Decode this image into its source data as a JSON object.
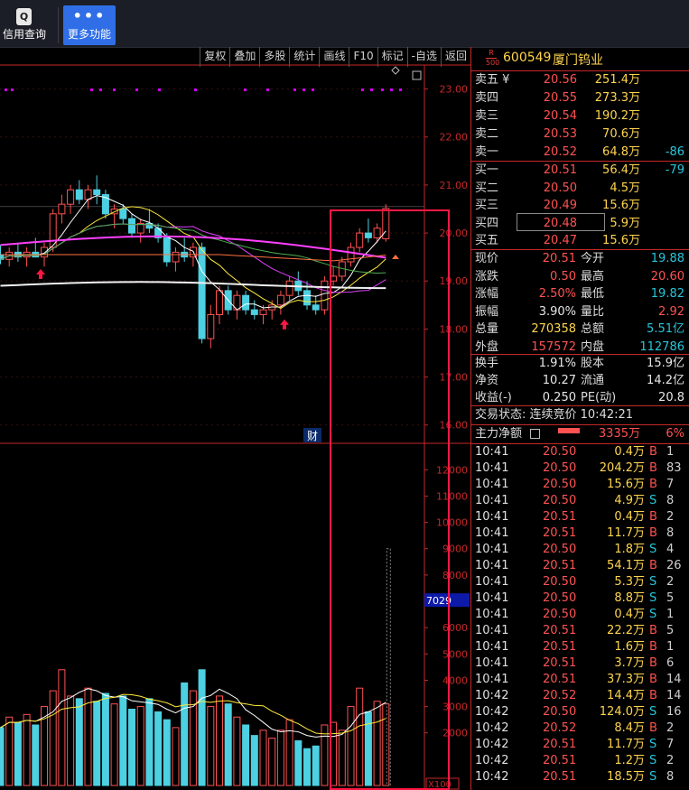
{
  "toolbar": {
    "credit_label": "信用查询",
    "credit_icon": "Q",
    "more_label": "更多功能",
    "more_icon": "•••"
  },
  "chart_toolbar": [
    "复权",
    "叠加",
    "多股",
    "统计",
    "画线",
    "F10",
    "标记",
    "-自选",
    "返回"
  ],
  "price_axis": [
    "23.00",
    "22.00",
    "21.00",
    "20.00",
    "19.00",
    "18.00",
    "17.00",
    "16.00"
  ],
  "volume_axis": [
    "12000",
    "11000",
    "10000",
    "9000",
    "8000",
    "7000",
    "6000",
    "5000",
    "4000",
    "3000",
    "2000"
  ],
  "volume_unit": "X100",
  "volume_marker": "7029",
  "chart_marker": "财",
  "stock": {
    "badge_r": "R",
    "badge_500": "500",
    "code": "600549",
    "name": "厦门钨业"
  },
  "asks": [
    {
      "label": "卖五 ¥",
      "price": "20.56",
      "vol": "251.4万",
      "diff": ""
    },
    {
      "label": "卖四",
      "price": "20.55",
      "vol": "273.3万",
      "diff": ""
    },
    {
      "label": "卖三",
      "price": "20.54",
      "vol": "190.2万",
      "diff": ""
    },
    {
      "label": "卖二",
      "price": "20.53",
      "vol": "70.6万",
      "diff": ""
    },
    {
      "label": "卖一",
      "price": "20.52",
      "vol": "64.8万",
      "diff": "-86"
    }
  ],
  "bids": [
    {
      "label": "买一",
      "price": "20.51",
      "vol": "56.4万",
      "diff": "-79"
    },
    {
      "label": "买二",
      "price": "20.50",
      "vol": "4.5万",
      "diff": ""
    },
    {
      "label": "买三",
      "price": "20.49",
      "vol": "15.6万",
      "diff": ""
    },
    {
      "label": "买四",
      "price": "20.48",
      "vol": "5.9万",
      "diff": ""
    },
    {
      "label": "买五",
      "price": "20.47",
      "vol": "15.6万",
      "diff": ""
    }
  ],
  "quote": [
    {
      "l1": "现价",
      "v1": "20.51",
      "c1": "red",
      "l2": "今开",
      "v2": "19.88",
      "c2": "cyan"
    },
    {
      "l1": "涨跌",
      "v1": "0.50",
      "c1": "red",
      "l2": "最高",
      "v2": "20.60",
      "c2": "red"
    },
    {
      "l1": "涨幅",
      "v1": "2.50%",
      "c1": "red",
      "l2": "最低",
      "v2": "19.82",
      "c2": "cyan"
    },
    {
      "l1": "振幅",
      "v1": "3.90%",
      "c1": "white",
      "l2": "量比",
      "v2": "2.92",
      "c2": "red"
    },
    {
      "l1": "总量",
      "v1": "270358",
      "c1": "yellow",
      "l2": "总额",
      "v2": "5.51亿",
      "c2": "cyan"
    },
    {
      "l1": "外盘",
      "v1": "157572",
      "c1": "red",
      "l2": "内盘",
      "v2": "112786",
      "c2": "cyan"
    }
  ],
  "fundamentals": [
    {
      "l1": "换手",
      "v1": "1.91%",
      "l2": "股本",
      "v2": "15.9亿"
    },
    {
      "l1": "净资",
      "v1": "10.27",
      "l2": "流通",
      "v2": "14.2亿"
    },
    {
      "l1": "收益(-)",
      "v1": "0.250",
      "l2": "PE(动)",
      "v2": "20.8"
    }
  ],
  "trading_status": "交易状态: 连续竞价 10:42:21",
  "main_fund": {
    "label": "主力净额",
    "value": "3335万",
    "pct": "6%"
  },
  "ticks": [
    {
      "time": "10:41",
      "price": "20.50",
      "vol": "0.4万",
      "side": "B",
      "count": "1"
    },
    {
      "time": "10:41",
      "price": "20.50",
      "vol": "204.2万",
      "side": "B",
      "count": "83"
    },
    {
      "time": "10:41",
      "price": "20.50",
      "vol": "15.6万",
      "side": "B",
      "count": "7"
    },
    {
      "time": "10:41",
      "price": "20.50",
      "vol": "4.9万",
      "side": "S",
      "count": "8"
    },
    {
      "time": "10:41",
      "price": "20.51",
      "vol": "0.4万",
      "side": "B",
      "count": "2"
    },
    {
      "time": "10:41",
      "price": "20.51",
      "vol": "11.7万",
      "side": "B",
      "count": "8"
    },
    {
      "time": "10:41",
      "price": "20.50",
      "vol": "1.8万",
      "side": "S",
      "count": "4"
    },
    {
      "time": "10:41",
      "price": "20.51",
      "vol": "54.1万",
      "side": "B",
      "count": "26"
    },
    {
      "time": "10:41",
      "price": "20.50",
      "vol": "5.3万",
      "side": "S",
      "count": "2"
    },
    {
      "time": "10:41",
      "price": "20.50",
      "vol": "8.8万",
      "side": "S",
      "count": "5"
    },
    {
      "time": "10:41",
      "price": "20.50",
      "vol": "0.4万",
      "side": "S",
      "count": "1"
    },
    {
      "time": "10:41",
      "price": "20.51",
      "vol": "22.2万",
      "side": "B",
      "count": "5"
    },
    {
      "time": "10:41",
      "price": "20.51",
      "vol": "1.6万",
      "side": "B",
      "count": "1"
    },
    {
      "time": "10:41",
      "price": "20.51",
      "vol": "3.7万",
      "side": "B",
      "count": "6"
    },
    {
      "time": "10:41",
      "price": "20.51",
      "vol": "37.3万",
      "side": "B",
      "count": "14"
    },
    {
      "time": "10:42",
      "price": "20.52",
      "vol": "14.4万",
      "side": "B",
      "count": "14"
    },
    {
      "time": "10:42",
      "price": "20.50",
      "vol": "124.0万",
      "side": "S",
      "count": "16"
    },
    {
      "time": "10:42",
      "price": "20.52",
      "vol": "8.4万",
      "side": "B",
      "count": "2"
    },
    {
      "time": "10:42",
      "price": "20.51",
      "vol": "11.7万",
      "side": "S",
      "count": "7"
    },
    {
      "time": "10:42",
      "price": "20.51",
      "vol": "1.2万",
      "side": "S",
      "count": "2"
    },
    {
      "time": "10:42",
      "price": "20.51",
      "vol": "18.5万",
      "side": "S",
      "count": "8"
    }
  ],
  "candles": [
    {
      "o": 19.55,
      "h": 19.75,
      "l": 19.35,
      "c": 19.45
    },
    {
      "o": 19.45,
      "h": 19.7,
      "l": 19.3,
      "c": 19.6
    },
    {
      "o": 19.6,
      "h": 19.8,
      "l": 19.4,
      "c": 19.5
    },
    {
      "o": 19.5,
      "h": 19.7,
      "l": 19.3,
      "c": 19.6
    },
    {
      "o": 19.6,
      "h": 19.9,
      "l": 19.5,
      "c": 19.5
    },
    {
      "o": 19.5,
      "h": 19.8,
      "l": 19.3,
      "c": 19.7
    },
    {
      "o": 19.7,
      "h": 20.5,
      "l": 19.6,
      "c": 20.4
    },
    {
      "o": 20.4,
      "h": 20.8,
      "l": 20.2,
      "c": 20.6
    },
    {
      "o": 20.6,
      "h": 21.0,
      "l": 20.4,
      "c": 20.9
    },
    {
      "o": 20.9,
      "h": 21.1,
      "l": 20.6,
      "c": 20.7
    },
    {
      "o": 20.7,
      "h": 21.0,
      "l": 20.5,
      "c": 20.9
    },
    {
      "o": 20.9,
      "h": 21.2,
      "l": 20.6,
      "c": 20.8
    },
    {
      "o": 20.8,
      "h": 20.9,
      "l": 20.3,
      "c": 20.4
    },
    {
      "o": 20.4,
      "h": 20.6,
      "l": 20.1,
      "c": 20.5
    },
    {
      "o": 20.5,
      "h": 20.6,
      "l": 20.2,
      "c": 20.3
    },
    {
      "o": 20.3,
      "h": 20.4,
      "l": 19.9,
      "c": 20.0
    },
    {
      "o": 20.0,
      "h": 20.3,
      "l": 19.8,
      "c": 20.2
    },
    {
      "o": 20.2,
      "h": 20.5,
      "l": 20.0,
      "c": 20.1
    },
    {
      "o": 20.1,
      "h": 20.2,
      "l": 19.8,
      "c": 19.9
    },
    {
      "o": 19.9,
      "h": 20.0,
      "l": 19.3,
      "c": 19.4
    },
    {
      "o": 19.4,
      "h": 19.7,
      "l": 19.2,
      "c": 19.6
    },
    {
      "o": 19.6,
      "h": 19.9,
      "l": 19.4,
      "c": 19.5
    },
    {
      "o": 19.5,
      "h": 19.8,
      "l": 19.3,
      "c": 19.7
    },
    {
      "o": 19.7,
      "h": 19.8,
      "l": 17.7,
      "c": 17.8
    },
    {
      "o": 17.8,
      "h": 18.5,
      "l": 17.6,
      "c": 18.3
    },
    {
      "o": 18.3,
      "h": 18.9,
      "l": 18.1,
      "c": 18.8
    },
    {
      "o": 18.8,
      "h": 18.9,
      "l": 18.3,
      "c": 18.4
    },
    {
      "o": 18.4,
      "h": 18.8,
      "l": 18.2,
      "c": 18.7
    },
    {
      "o": 18.7,
      "h": 18.8,
      "l": 18.3,
      "c": 18.4
    },
    {
      "o": 18.4,
      "h": 18.6,
      "l": 18.2,
      "c": 18.3
    },
    {
      "o": 18.3,
      "h": 18.5,
      "l": 18.1,
      "c": 18.4
    },
    {
      "o": 18.4,
      "h": 18.6,
      "l": 18.2,
      "c": 18.5
    },
    {
      "o": 18.5,
      "h": 18.8,
      "l": 18.3,
      "c": 18.7
    },
    {
      "o": 18.7,
      "h": 19.1,
      "l": 18.6,
      "c": 19.0
    },
    {
      "o": 19.0,
      "h": 19.2,
      "l": 18.7,
      "c": 18.8
    },
    {
      "o": 18.8,
      "h": 19.0,
      "l": 18.4,
      "c": 18.5
    },
    {
      "o": 18.5,
      "h": 18.7,
      "l": 18.3,
      "c": 18.4
    },
    {
      "o": 18.4,
      "h": 19.1,
      "l": 18.3,
      "c": 19.0
    },
    {
      "o": 19.0,
      "h": 19.3,
      "l": 18.9,
      "c": 19.1
    },
    {
      "o": 19.1,
      "h": 19.5,
      "l": 19.0,
      "c": 19.4
    },
    {
      "o": 19.4,
      "h": 19.8,
      "l": 19.3,
      "c": 19.7
    },
    {
      "o": 19.7,
      "h": 20.1,
      "l": 19.6,
      "c": 20.0
    },
    {
      "o": 20.0,
      "h": 20.3,
      "l": 19.8,
      "c": 19.9
    },
    {
      "o": 19.9,
      "h": 20.2,
      "l": 19.8,
      "c": 20.1
    },
    {
      "o": 19.88,
      "h": 20.6,
      "l": 19.82,
      "c": 20.51
    }
  ],
  "volumes": [
    2200,
    2600,
    2400,
    2700,
    2300,
    3000,
    3600,
    4400,
    3400,
    3300,
    3700,
    3200,
    3500,
    3100,
    3400,
    2900,
    3000,
    3300,
    2800,
    2500,
    2200,
    3900,
    3600,
    4400,
    3000,
    3400,
    3100,
    2600,
    2300,
    1900,
    2100,
    1800,
    2100,
    2500,
    1700,
    1400,
    1500,
    2300,
    2400,
    2100,
    3000,
    3700,
    2800,
    3200,
    3100
  ]
}
